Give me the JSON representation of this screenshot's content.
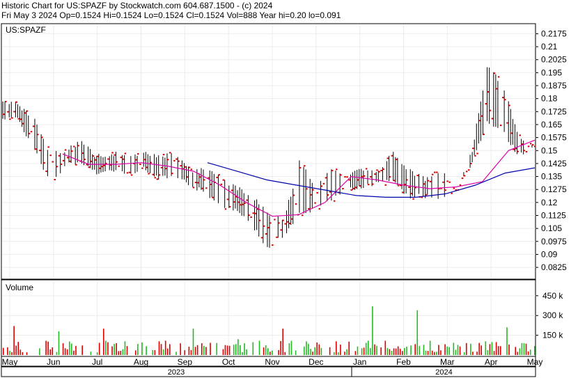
{
  "header": {
    "line1": "Historic Chart for US:SPAZF by Stockwatch.com 604.687.1500 - (c) 2024",
    "line2": "Fri May  3 2024  Op=0.1524  Hi=0.1524  Lo=0.1524  Cl=0.1524  Vol=888  Year hi=0.20  lo=0.091"
  },
  "price_panel": {
    "symbol": "US:SPAZF"
  },
  "volume_panel": {
    "label": "Volume"
  },
  "years": [
    "2023",
    "2024"
  ],
  "colors": {
    "price_bar": "#000000",
    "close_tick": "#dd0000",
    "ma_short": "#dd00aa",
    "ma_long": "#0000aa",
    "vol_up": "#22bb22",
    "vol_down": "#dd0000"
  },
  "chart_data": [
    {
      "type": "ohlc",
      "title": "US:SPAZF",
      "y_ticks": [
        0.2175,
        0.21,
        0.2025,
        0.195,
        0.1875,
        0.18,
        0.1725,
        0.165,
        0.1575,
        0.15,
        0.1425,
        0.135,
        0.1275,
        0.12,
        0.1125,
        0.105,
        0.0975,
        0.09,
        0.0825
      ],
      "ylim": [
        0.0765,
        0.2225
      ],
      "x_ticks": [
        "May",
        "Jun",
        "Jul",
        "Aug",
        "Sep",
        "Oct",
        "Nov",
        "Dec",
        "Jan",
        "Feb",
        "Mar",
        "Apr",
        "May"
      ],
      "x_groups": [
        "2023",
        "2024"
      ],
      "waypoints_high_low": [
        [
          0.18,
          0.168
        ],
        [
          0.178,
          0.166
        ],
        [
          0.17,
          0.15
        ],
        [
          0.15,
          0.13
        ],
        [
          0.152,
          0.14
        ],
        [
          0.156,
          0.142
        ],
        [
          0.148,
          0.136
        ],
        [
          0.15,
          0.136
        ],
        [
          0.148,
          0.135
        ],
        [
          0.15,
          0.138
        ],
        [
          0.148,
          0.132
        ],
        [
          0.15,
          0.135
        ],
        [
          0.14,
          0.128
        ],
        [
          0.14,
          0.125
        ],
        [
          0.135,
          0.115
        ],
        [
          0.13,
          0.115
        ],
        [
          0.125,
          0.105
        ],
        [
          0.115,
          0.092
        ],
        [
          0.112,
          0.1
        ],
        [
          0.145,
          0.112
        ],
        [
          0.13,
          0.115
        ],
        [
          0.14,
          0.12
        ],
        [
          0.138,
          0.125
        ],
        [
          0.14,
          0.128
        ],
        [
          0.14,
          0.13
        ],
        [
          0.15,
          0.13
        ],
        [
          0.14,
          0.122
        ],
        [
          0.135,
          0.122
        ],
        [
          0.14,
          0.122
        ],
        [
          0.13,
          0.125
        ],
        [
          0.15,
          0.14
        ],
        [
          0.2,
          0.165
        ],
        [
          0.19,
          0.16
        ],
        [
          0.16,
          0.145
        ],
        [
          0.1524,
          0.1524
        ]
      ],
      "series": [
        {
          "name": "",
          "kind": "moving_average_short",
          "values": [
            0.148,
            0.142,
            0.142,
            0.143,
            0.141,
            0.138,
            0.13,
            0.12,
            0.112,
            0.113,
            0.12,
            0.135,
            0.133,
            0.13,
            0.128,
            0.129,
            0.132,
            0.15,
            0.156
          ]
        },
        {
          "name": "",
          "kind": "moving_average_long",
          "values": [
            0.143,
            0.138,
            0.133,
            0.13,
            0.127,
            0.124,
            0.123,
            0.123,
            0.125,
            0.13,
            0.137,
            0.14
          ]
        }
      ]
    },
    {
      "type": "bar",
      "title": "Volume",
      "y_ticks": [
        "450 k",
        "300 k",
        "150 k"
      ],
      "y_tick_values": [
        450000,
        300000,
        150000
      ],
      "ylim": [
        0,
        560000
      ],
      "peaks": [
        220000,
        180000,
        200000,
        150000,
        200000,
        120000,
        200000,
        160000,
        370000,
        340000,
        270000,
        210000
      ]
    }
  ]
}
